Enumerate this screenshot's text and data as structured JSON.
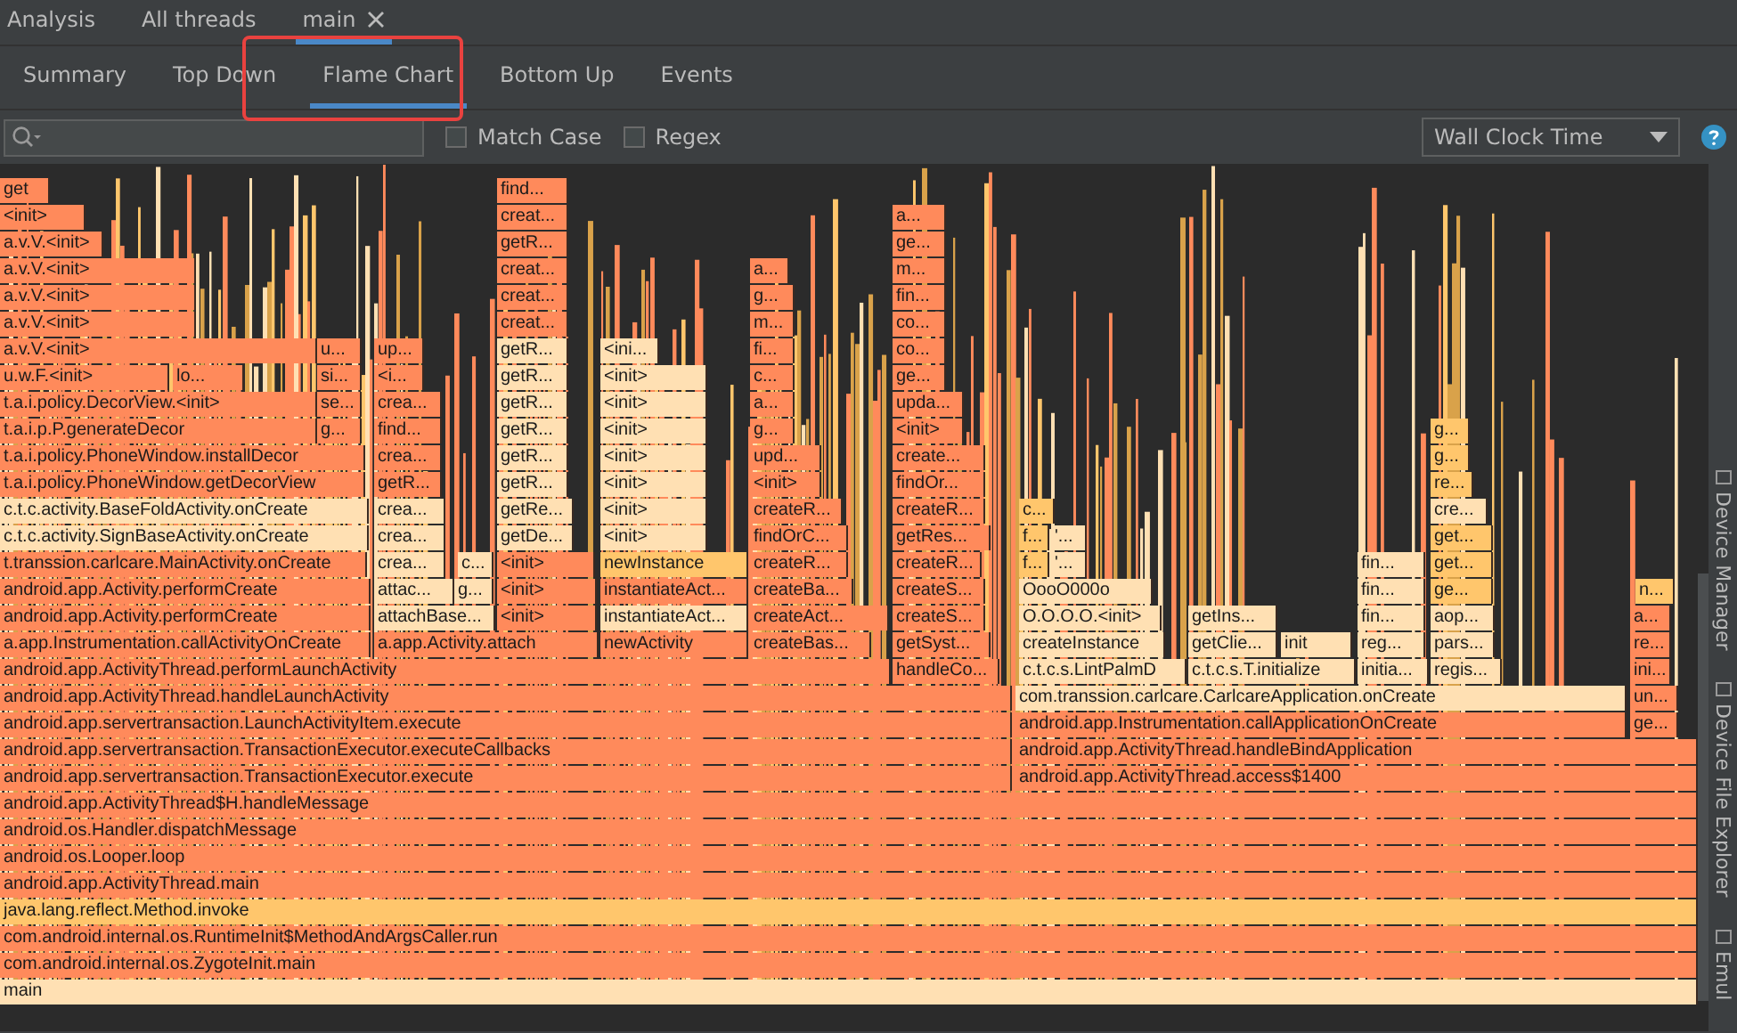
{
  "thread_tabs": [
    {
      "label": "Analysis",
      "selected": false,
      "closable": false
    },
    {
      "label": "All threads",
      "selected": false,
      "closable": false
    },
    {
      "label": "main",
      "selected": true,
      "closable": true
    }
  ],
  "view_tabs": [
    {
      "label": "Summary",
      "selected": false
    },
    {
      "label": "Top Down",
      "selected": false
    },
    {
      "label": "Flame Chart",
      "selected": true
    },
    {
      "label": "Bottom Up",
      "selected": false
    },
    {
      "label": "Events",
      "selected": false
    }
  ],
  "toolbar": {
    "options": [
      {
        "label": "Match Case",
        "checked": false
      },
      {
        "label": "Regex",
        "checked": false
      }
    ],
    "clock": "Wall Clock Time"
  },
  "flame_chart": {
    "rows": [
      {
        "frames": [
          {
            "label": "get",
            "color": "#ff8a5b"
          },
          {
            "label": "find...",
            "color": "#ff8a5b"
          }
        ]
      },
      {
        "frames": [
          {
            "label": "<init>",
            "color": "#ff8a5b"
          },
          {
            "label": "creat...",
            "color": "#ff8a5b"
          },
          {
            "label": "a...",
            "color": "#ff8a5b"
          }
        ]
      },
      {
        "frames": [
          {
            "label": "a.v.V.<init>",
            "color": "#ff8a5b"
          },
          {
            "label": "getR...",
            "color": "#ff8a5b"
          },
          {
            "label": "ge...",
            "color": "#ff8a5b"
          }
        ]
      },
      {
        "frames": [
          {
            "label": "a.v.V.<init>",
            "color": "#ff8a5b"
          },
          {
            "label": "creat...",
            "color": "#ff8a5b"
          },
          {
            "label": "a...",
            "color": "#ff8a5b"
          },
          {
            "label": "m...",
            "color": "#ff8a5b"
          }
        ]
      },
      {
        "frames": [
          {
            "label": "a.v.V.<init>",
            "color": "#ff8a5b"
          },
          {
            "label": "creat...",
            "color": "#ff8a5b"
          },
          {
            "label": "g...",
            "color": "#ff8a5b"
          },
          {
            "label": "fin...",
            "color": "#ff8a5b"
          }
        ]
      },
      {
        "frames": [
          {
            "label": "a.v.V.<init>",
            "color": "#ff8a5b"
          },
          {
            "label": "creat...",
            "color": "#ff8a5b"
          },
          {
            "label": "m...",
            "color": "#ff8a5b"
          },
          {
            "label": "co...",
            "color": "#ff8a5b"
          }
        ]
      },
      {
        "frames": [
          {
            "label": "a.v.V.<init>",
            "color": "#ff8a5b"
          },
          {
            "label": "u...",
            "color": "#ff8a5b"
          },
          {
            "label": "up...",
            "color": "#ff8a5b"
          },
          {
            "label": "getR...",
            "color": "#ffe0b3"
          },
          {
            "label": "<ini...",
            "color": "#ffe0b3"
          },
          {
            "label": "fi...",
            "color": "#ff8a5b"
          },
          {
            "label": "co...",
            "color": "#ff8a5b"
          }
        ]
      },
      {
        "frames": [
          {
            "label": "u.w.F.<init>",
            "color": "#ff8a5b"
          },
          {
            "label": "lo...",
            "color": "#ff8a5b"
          },
          {
            "label": "si...",
            "color": "#ff8a5b"
          },
          {
            "label": "<i...",
            "color": "#ff8a5b"
          },
          {
            "label": "getR...",
            "color": "#ffe0b3"
          },
          {
            "label": "<init>",
            "color": "#ffe0b3"
          },
          {
            "label": "c...",
            "color": "#ff8a5b"
          },
          {
            "label": "ge...",
            "color": "#ff8a5b"
          }
        ]
      },
      {
        "frames": [
          {
            "label": "t.a.i.policy.DecorView.<init>",
            "color": "#ff8a5b"
          },
          {
            "label": "se...",
            "color": "#ff8a5b"
          },
          {
            "label": "crea...",
            "color": "#ff8a5b"
          },
          {
            "label": "getR...",
            "color": "#ffe0b3"
          },
          {
            "label": "<init>",
            "color": "#ffe0b3"
          },
          {
            "label": "a...",
            "color": "#ff8a5b"
          },
          {
            "label": "upda...",
            "color": "#ff8a5b"
          }
        ]
      },
      {
        "frames": [
          {
            "label": "t.a.i.p.P.generateDecor",
            "color": "#ff8a5b"
          },
          {
            "label": "g...",
            "color": "#ff8a5b"
          },
          {
            "label": "find...",
            "color": "#ff8a5b"
          },
          {
            "label": "getR...",
            "color": "#ffe0b3"
          },
          {
            "label": "<init>",
            "color": "#ffe0b3"
          },
          {
            "label": "g...",
            "color": "#ff8a5b"
          },
          {
            "label": "<init>",
            "color": "#ff8a5b"
          },
          {
            "label": "g...",
            "color": "#ffc66c"
          }
        ]
      },
      {
        "frames": [
          {
            "label": "t.a.i.policy.PhoneWindow.installDecor",
            "color": "#ff8a5b"
          },
          {
            "label": "crea...",
            "color": "#ff8a5b"
          },
          {
            "label": "getR...",
            "color": "#ffe0b3"
          },
          {
            "label": "<init>",
            "color": "#ffe0b3"
          },
          {
            "label": "upd...",
            "color": "#ff8a5b"
          },
          {
            "label": "create...",
            "color": "#ff8a5b"
          },
          {
            "label": "g...",
            "color": "#ffc66c"
          }
        ]
      },
      {
        "frames": [
          {
            "label": "t.a.i.policy.PhoneWindow.getDecorView",
            "color": "#ff8a5b"
          },
          {
            "label": "getR...",
            "color": "#ff8a5b"
          },
          {
            "label": "getR...",
            "color": "#ffe0b3"
          },
          {
            "label": "<init>",
            "color": "#ffe0b3"
          },
          {
            "label": "<init>",
            "color": "#ff8a5b"
          },
          {
            "label": "findOr...",
            "color": "#ff8a5b"
          },
          {
            "label": "re...",
            "color": "#ffc66c"
          }
        ]
      },
      {
        "frames": [
          {
            "label": "c.t.c.activity.BaseFoldActivity.onCreate",
            "color": "#ffe0b3"
          },
          {
            "label": "crea...",
            "color": "#ffe0b3"
          },
          {
            "label": "getRe...",
            "color": "#ffe0b3"
          },
          {
            "label": "<init>",
            "color": "#ffe0b3"
          },
          {
            "label": "createR...",
            "color": "#ff8a5b"
          },
          {
            "label": "createR...",
            "color": "#ff8a5b"
          },
          {
            "label": "c...",
            "color": "#ffc66c"
          },
          {
            "label": "cre...",
            "color": "#ffe0b3"
          }
        ]
      },
      {
        "frames": [
          {
            "label": "c.t.c.activity.SignBaseActivity.onCreate",
            "color": "#ffe0b3"
          },
          {
            "label": "crea...",
            "color": "#ffe0b3"
          },
          {
            "label": "getDe...",
            "color": "#ffe0b3"
          },
          {
            "label": "<init>",
            "color": "#ffe0b3"
          },
          {
            "label": "findOrC...",
            "color": "#ff8a5b"
          },
          {
            "label": "getRes...",
            "color": "#ff8a5b"
          },
          {
            "label": "f...",
            "color": "#ffc66c"
          },
          {
            "label": "'...",
            "color": "#ffe0b3"
          },
          {
            "label": "get...",
            "color": "#ffc66c"
          }
        ]
      },
      {
        "frames": [
          {
            "label": "t.transsion.carlcare.MainActivity.onCreate",
            "color": "#ff8a5b"
          },
          {
            "label": "crea...",
            "color": "#ffe0b3"
          },
          {
            "label": "c...",
            "color": "#ffe0b3"
          },
          {
            "label": "<init>",
            "color": "#ff8a5b"
          },
          {
            "label": "newInstance",
            "color": "#ffc66c"
          },
          {
            "label": "createR...",
            "color": "#ff8a5b"
          },
          {
            "label": "createR...",
            "color": "#ff8a5b"
          },
          {
            "label": "f...",
            "color": "#ffc66c"
          },
          {
            "label": "'...",
            "color": "#ffe0b3"
          },
          {
            "label": "fin...",
            "color": "#ffe0b3"
          },
          {
            "label": "get...",
            "color": "#ffc66c"
          }
        ]
      },
      {
        "frames": [
          {
            "label": "android.app.Activity.performCreate",
            "color": "#ff8a5b"
          },
          {
            "label": "attac...",
            "color": "#ffe0b3"
          },
          {
            "label": "g...",
            "color": "#ffe0b3"
          },
          {
            "label": "<init>",
            "color": "#ff8a5b"
          },
          {
            "label": "instantiateAct...",
            "color": "#ff8a5b"
          },
          {
            "label": "createBa...",
            "color": "#ff8a5b"
          },
          {
            "label": "createS...",
            "color": "#ff8a5b"
          },
          {
            "label": "OooO000o",
            "color": "#ffe0b3"
          },
          {
            "label": "fin...",
            "color": "#ffe0b3"
          },
          {
            "label": "ge...",
            "color": "#ffc66c"
          },
          {
            "label": "n...",
            "color": "#ffc66c"
          }
        ]
      },
      {
        "frames": [
          {
            "label": "android.app.Activity.performCreate",
            "color": "#ff8a5b"
          },
          {
            "label": "attachBase...",
            "color": "#ffe0b3"
          },
          {
            "label": "<init>",
            "color": "#ff8a5b"
          },
          {
            "label": "instantiateAct...",
            "color": "#ffe0b3"
          },
          {
            "label": "createAct...",
            "color": "#ff8a5b"
          },
          {
            "label": "createS...",
            "color": "#ff8a5b"
          },
          {
            "label": "O.O.O.O.<init>",
            "color": "#ffe0b3"
          },
          {
            "label": "getIns...",
            "color": "#ffe0b3"
          },
          {
            "label": "fin...",
            "color": "#ffe0b3"
          },
          {
            "label": "aop...",
            "color": "#ffe0b3"
          },
          {
            "label": "a...",
            "color": "#ff8a5b"
          }
        ]
      },
      {
        "frames": [
          {
            "label": "a.app.Instrumentation.callActivityOnCreate",
            "color": "#ff8a5b"
          },
          {
            "label": "a.app.Activity.attach",
            "color": "#ff8a5b"
          },
          {
            "label": "newActivity",
            "color": "#ff8a5b"
          },
          {
            "label": "createBas...",
            "color": "#ff8a5b"
          },
          {
            "label": "getSyst...",
            "color": "#ff8a5b"
          },
          {
            "label": "createInstance",
            "color": "#ffe0b3"
          },
          {
            "label": "getClie...",
            "color": "#ffe0b3"
          },
          {
            "label": "init",
            "color": "#ffe0b3"
          },
          {
            "label": "reg...",
            "color": "#ffe0b3"
          },
          {
            "label": "pars...",
            "color": "#ffe0b3"
          },
          {
            "label": "re...",
            "color": "#ff8a5b"
          }
        ]
      },
      {
        "frames": [
          {
            "label": "android.app.ActivityThread.performLaunchActivity",
            "color": "#ff8a5b"
          },
          {
            "label": "handleCo...",
            "color": "#ff8a5b"
          },
          {
            "label": "c.t.c.s.LintPalmD",
            "color": "#ffe0b3"
          },
          {
            "label": "c.t.c.s.T.initialize",
            "color": "#ffe0b3"
          },
          {
            "label": "initia...",
            "color": "#ffe0b3"
          },
          {
            "label": "regis...",
            "color": "#ffe0b3"
          },
          {
            "label": "ini...",
            "color": "#ff8a5b"
          }
        ]
      },
      {
        "frames": [
          {
            "label": "android.app.ActivityThread.handleLaunchActivity",
            "color": "#ff8a5b"
          },
          {
            "label": "com.transsion.carlcare.CarlcareApplication.onCreate",
            "color": "#ffe0b3"
          },
          {
            "label": "un...",
            "color": "#ff8a5b"
          }
        ]
      },
      {
        "frames": [
          {
            "label": "android.app.servertransaction.LaunchActivityItem.execute",
            "color": "#ff8a5b"
          },
          {
            "label": "android.app.Instrumentation.callApplicationOnCreate",
            "color": "#ff8a5b"
          },
          {
            "label": "ge...",
            "color": "#ff8a5b"
          }
        ]
      },
      {
        "frames": [
          {
            "label": "android.app.servertransaction.TransactionExecutor.executeCallbacks",
            "color": "#ff8a5b"
          },
          {
            "label": "android.app.ActivityThread.handleBindApplication",
            "color": "#ff8a5b"
          }
        ]
      },
      {
        "frames": [
          {
            "label": "android.app.servertransaction.TransactionExecutor.execute",
            "color": "#ff8a5b"
          },
          {
            "label": "android.app.ActivityThread.access$1400",
            "color": "#ff8a5b"
          }
        ]
      },
      {
        "frames": [
          {
            "label": "android.app.ActivityThread$H.handleMessage",
            "color": "#ff8a5b"
          }
        ]
      },
      {
        "frames": [
          {
            "label": "android.os.Handler.dispatchMessage",
            "color": "#ff8a5b"
          }
        ]
      },
      {
        "frames": [
          {
            "label": "android.os.Looper.loop",
            "color": "#ff8a5b"
          }
        ]
      },
      {
        "frames": [
          {
            "label": "android.app.ActivityThread.main",
            "color": "#ff8a5b"
          }
        ]
      },
      {
        "frames": [
          {
            "label": "java.lang.reflect.Method.invoke",
            "color": "#ffc66c"
          }
        ]
      },
      {
        "frames": [
          {
            "label": "com.android.internal.os.RuntimeInit$MethodAndArgsCaller.run",
            "color": "#ff8a5b"
          }
        ]
      },
      {
        "frames": [
          {
            "label": "com.android.internal.os.ZygoteInit.main",
            "color": "#ff8a5b"
          }
        ]
      },
      {
        "frames": [
          {
            "label": "main",
            "color": "#ffe0b3"
          }
        ]
      }
    ]
  },
  "side_tools": [
    "Device Manager",
    "Device File Explorer",
    "Emul"
  ]
}
